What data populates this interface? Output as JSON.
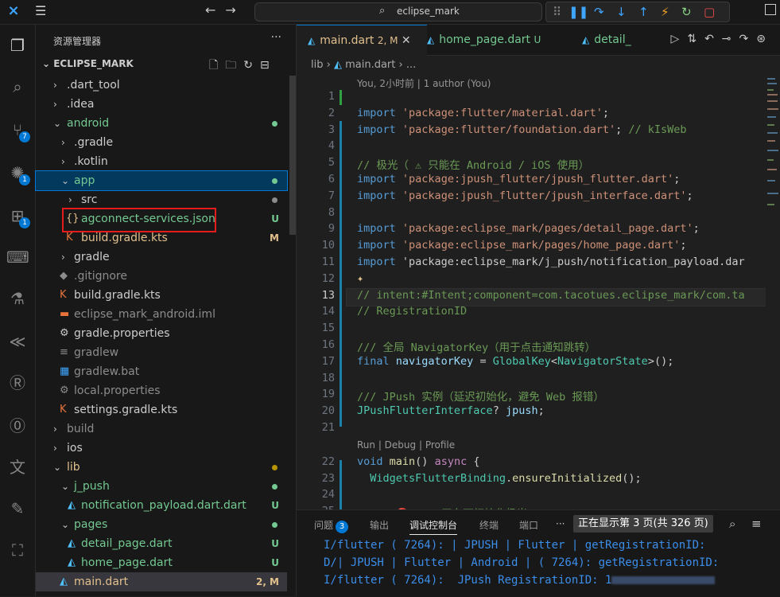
{
  "titlebar": {
    "search_text": "eclipse_mark",
    "menu_icon": "hamburger-icon",
    "logo": "vscode-logo"
  },
  "activity": {
    "badges": {
      "scm": "7",
      "debug": "1",
      "extensions": "1"
    }
  },
  "sidebar": {
    "header": "资源管理器",
    "section": "ECLIPSE_MARK",
    "tree": [
      {
        "label": ".dart_tool",
        "status": ""
      },
      {
        "label": ".idea",
        "status": ""
      },
      {
        "label": "android",
        "status": ""
      },
      {
        "label": ".gradle",
        "status": ""
      },
      {
        "label": ".kotlin",
        "status": ""
      },
      {
        "label": "app",
        "status": ""
      },
      {
        "label": "src",
        "status": ""
      },
      {
        "label": "agconnect-services.json",
        "status": "U"
      },
      {
        "label": "build.gradle.kts",
        "status": "M"
      },
      {
        "label": "gradle",
        "status": ""
      },
      {
        "label": ".gitignore",
        "status": ""
      },
      {
        "label": "build.gradle.kts",
        "status": ""
      },
      {
        "label": "eclipse_mark_android.iml",
        "status": ""
      },
      {
        "label": "gradle.properties",
        "status": ""
      },
      {
        "label": "gradlew",
        "status": ""
      },
      {
        "label": "gradlew.bat",
        "status": ""
      },
      {
        "label": "local.properties",
        "status": ""
      },
      {
        "label": "settings.gradle.kts",
        "status": ""
      },
      {
        "label": "build",
        "status": ""
      },
      {
        "label": "ios",
        "status": ""
      },
      {
        "label": "lib",
        "status": ""
      },
      {
        "label": "j_push",
        "status": ""
      },
      {
        "label": "notification_payload.dart.dart",
        "status": "U"
      },
      {
        "label": "pages",
        "status": ""
      },
      {
        "label": "detail_page.dart",
        "status": "U"
      },
      {
        "label": "home_page.dart",
        "status": "U"
      },
      {
        "label": "main.dart",
        "status": "2, M"
      }
    ]
  },
  "tabs": [
    {
      "label": "main.dart",
      "status": "2, M"
    },
    {
      "label": "home_page.dart",
      "status": "U"
    },
    {
      "label": "detail_"
    }
  ],
  "breadcrumb": {
    "folder": "lib",
    "file": "main.dart",
    "rest": "..."
  },
  "blame": "You, 2小时前 | 1 author (You)",
  "code": {
    "codelens": "Run | Debug | Profile",
    "line_numbers": [
      "1",
      "2",
      "3",
      "4",
      "5",
      "6",
      "7",
      "8",
      "9",
      "10",
      "11",
      "12",
      "13",
      "14",
      "15",
      "16",
      "17",
      "18",
      "19",
      "20",
      "21",
      "22",
      "23",
      "24",
      "25"
    ],
    "lines": [
      "",
      "import 'package:flutter/material.dart';",
      "import 'package:flutter/foundation.dart'; // kIsWeb",
      "",
      "// 极光（ ⚠ 只能在 Android / iOS 使用）",
      "import 'package:jpush_flutter/jpush_flutter.dart';",
      "import 'package:jpush_flutter/jpush_interface.dart';",
      "",
      "import 'package:eclipse_mark/pages/detail_page.dart';",
      "import 'package:eclipse_mark/pages/home_page.dart';",
      "import 'package:eclipse_mark/j_push/notification_payload.dar",
      "",
      "// intent:#Intent;component=com.tacotues.eclipse_mark/com.ta",
      "// RegistrationID",
      "",
      "/// 全局 NavigatorKey（用于点击通知跳转）",
      "final navigatorKey = GlobalKey<NavigatorState>();",
      "",
      "/// JPush 实例（延迟初始化，避免 Web 报错）",
      "JPushFlutterInterface? jpush;",
      "",
      "void main() async {",
      "  WidgetsFlutterBinding.ensureInitialized();",
      "",
      "  /// 🔴 Web 平台下初始化极光"
    ]
  },
  "panel": {
    "tabs": [
      "问题",
      "输出",
      "调试控制台",
      "终端",
      "端口"
    ],
    "problems_count": "3",
    "page_info": "正在显示第 3 页(共 326 页)",
    "output": [
      "I/flutter ( 7264): | JPUSH | Flutter | getRegistrationID:",
      "D/| JPUSH | Flutter | Android | ( 7264): getRegistrationID:",
      "I/flutter ( 7264):  JPush RegistrationID: 1"
    ]
  },
  "colors": {
    "accent": "#0078d4",
    "untracked": "#73c991",
    "modified": "#e2c08d",
    "highlight_box": "#e51c1c"
  }
}
